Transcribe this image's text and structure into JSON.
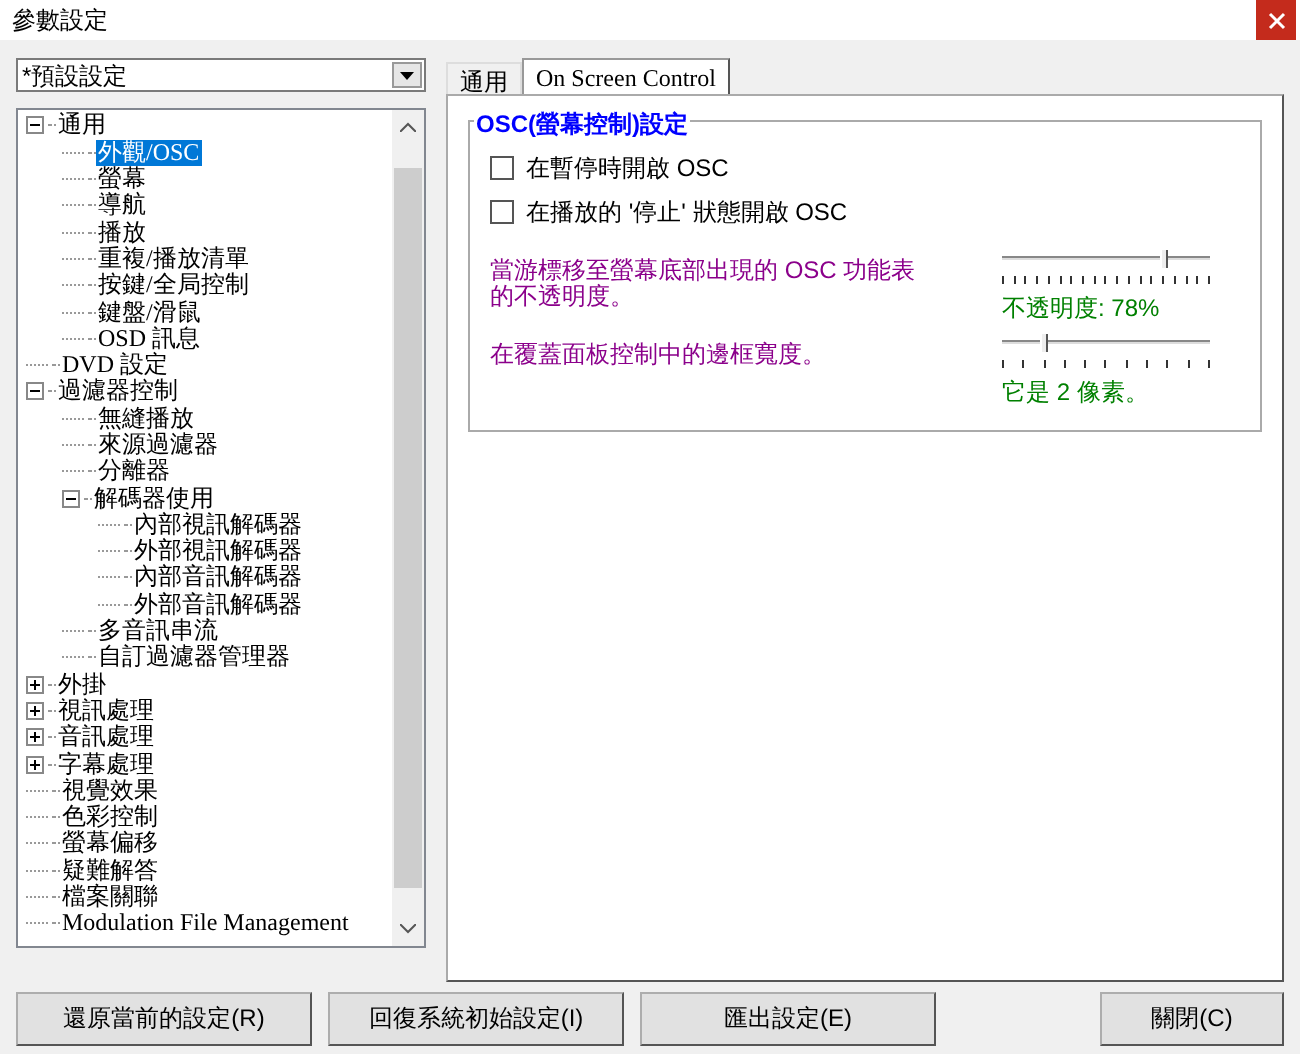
{
  "window": {
    "title": "參數設定"
  },
  "profile": {
    "value": "*預設設定"
  },
  "tree": [
    {
      "label": "通用",
      "expanded": true,
      "selected": false,
      "children": [
        {
          "label": "外觀/OSC",
          "selected": true
        },
        {
          "label": "螢幕",
          "selected": false
        },
        {
          "label": "導航",
          "selected": false
        },
        {
          "label": "播放",
          "selected": false
        },
        {
          "label": "重複/播放清單",
          "selected": false
        },
        {
          "label": "按鍵/全局控制",
          "selected": false
        },
        {
          "label": "鍵盤/滑鼠",
          "selected": false
        },
        {
          "label": "OSD 訊息",
          "selected": false
        }
      ]
    },
    {
      "label": "DVD 設定",
      "selected": false
    },
    {
      "label": "過濾器控制",
      "expanded": true,
      "selected": false,
      "children": [
        {
          "label": "無縫播放",
          "selected": false
        },
        {
          "label": "來源過濾器",
          "selected": false
        },
        {
          "label": "分離器",
          "selected": false
        },
        {
          "label": "解碼器使用",
          "expanded": true,
          "selected": false,
          "children": [
            {
              "label": "內部視訊解碼器",
              "selected": false
            },
            {
              "label": "外部視訊解碼器",
              "selected": false
            },
            {
              "label": "內部音訊解碼器",
              "selected": false
            },
            {
              "label": "外部音訊解碼器",
              "selected": false
            }
          ]
        },
        {
          "label": "多音訊串流",
          "selected": false
        },
        {
          "label": "自訂過濾器管理器",
          "selected": false
        }
      ]
    },
    {
      "label": "外掛",
      "expanded": false,
      "selected": false
    },
    {
      "label": "視訊處理",
      "expanded": false,
      "selected": false
    },
    {
      "label": "音訊處理",
      "expanded": false,
      "selected": false
    },
    {
      "label": "字幕處理",
      "expanded": false,
      "selected": false
    },
    {
      "label": "視覺效果",
      "selected": false
    },
    {
      "label": "色彩控制",
      "selected": false
    },
    {
      "label": "螢幕偏移",
      "selected": false
    },
    {
      "label": "疑難解答",
      "selected": false
    },
    {
      "label": "檔案關聯",
      "selected": false
    },
    {
      "label": "Modulation File Management",
      "selected": false
    }
  ],
  "tabs": [
    {
      "label": "通用",
      "selected": false
    },
    {
      "label": "On Screen Control",
      "selected": true
    }
  ],
  "group": {
    "title": "OSC(螢幕控制)設定",
    "checkboxes": [
      {
        "label": "在暫停時開啟 OSC",
        "checked": false
      },
      {
        "label": "在播放的 '停止' 狀態開啟 OSC",
        "checked": false
      }
    ],
    "sliders": [
      {
        "label": "當游標移至螢幕底部出現的 OSC 功能表的不透明度。",
        "level": 0.78,
        "reading": "不透明度: 78%"
      },
      {
        "label": "在覆蓋面板控制中的邊框寬度。",
        "level": 0.2,
        "reading": "它是 2 像素。"
      }
    ]
  },
  "buttons": [
    {
      "label": "還原當前的設定(R)"
    },
    {
      "label": "回復系統初始設定(I)"
    },
    {
      "label": "匯出設定(E)"
    }
  ],
  "close_button": {
    "label": "關閉(C)"
  }
}
